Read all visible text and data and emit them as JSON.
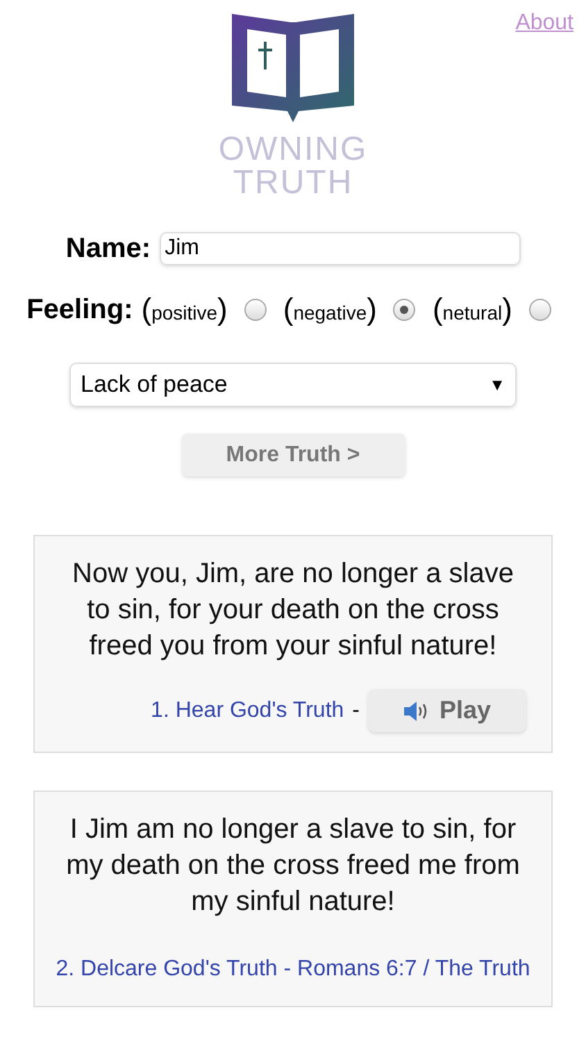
{
  "header": {
    "logo_line_1": "OWNING",
    "logo_line_2": "TRUTH",
    "about_link": "About"
  },
  "form": {
    "name_label": "Name:",
    "name_value": "Jim",
    "feeling_label": "Feeling:",
    "feelings": [
      {
        "open": "(",
        "label": "positive",
        "close": ")",
        "selected": false
      },
      {
        "open": "(",
        "label": "negative",
        "close": ")",
        "selected": true
      },
      {
        "open": "(",
        "label": "netural",
        "close": ")",
        "selected": false
      }
    ],
    "topic": "Lack of peace",
    "topic_caret": "▼",
    "more_button": "More Truth >"
  },
  "cards": [
    {
      "kind": "play",
      "text": "Now you, Jim, are no longer a slave to sin, for your death on the cross freed you from your sinful nature!",
      "link": "1. Hear God's Truth",
      "separator": "-",
      "button": "Play"
    },
    {
      "kind": "plain",
      "text": "I Jim am no longer a slave to sin, for my death on the cross freed me from my sinful nature!",
      "link": "2. Delcare God's Truth - Romans 6:7 / The Truth"
    }
  ]
}
